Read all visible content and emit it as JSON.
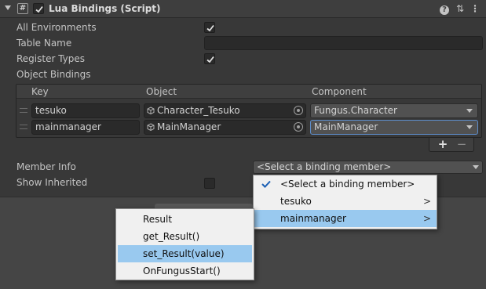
{
  "header": {
    "title": "Lua Bindings (Script)",
    "script_icon_glyph": "#",
    "enabled": true,
    "help_glyph": "?",
    "presets_glyph": "⇅",
    "menu_glyph": "⋮"
  },
  "fields": {
    "all_environments": {
      "label": "All Environments",
      "checked": true
    },
    "table_name": {
      "label": "Table Name",
      "value": ""
    },
    "register_types": {
      "label": "Register Types",
      "checked": true
    },
    "object_bindings": {
      "label": "Object Bindings"
    }
  },
  "table": {
    "columns": [
      "Key",
      "Object",
      "Component"
    ],
    "rows": [
      {
        "key": "tesuko",
        "object": "Character_Tesuko",
        "component": "Fungus.Character"
      },
      {
        "key": "mainmanager",
        "object": "MainManager",
        "component": "MainManager"
      }
    ],
    "add_glyph": "+",
    "remove_glyph": "−"
  },
  "member_info": {
    "label": "Member Info",
    "value": "<Select a binding member>"
  },
  "show_inherited": {
    "label": "Show Inherited",
    "checked": false
  },
  "binding_menu": {
    "items": [
      {
        "label": "<Select a binding member>",
        "checked": true,
        "submenu": false
      },
      {
        "label": "tesuko",
        "checked": false,
        "submenu": true
      },
      {
        "label": "mainmanager",
        "checked": false,
        "submenu": true,
        "highlighted": true
      }
    ],
    "submenu_glyph": ">"
  },
  "member_submenu": {
    "items": [
      {
        "label": "Result"
      },
      {
        "label": "get_Result()"
      },
      {
        "label": "set_Result(value)",
        "highlighted": true
      },
      {
        "label": "OnFungusStart()"
      }
    ]
  },
  "colors": {
    "background": "#383838",
    "menu_background": "#f0f0f0",
    "menu_highlight": "#99c9ef",
    "selected_border": "#5e8ecc"
  }
}
